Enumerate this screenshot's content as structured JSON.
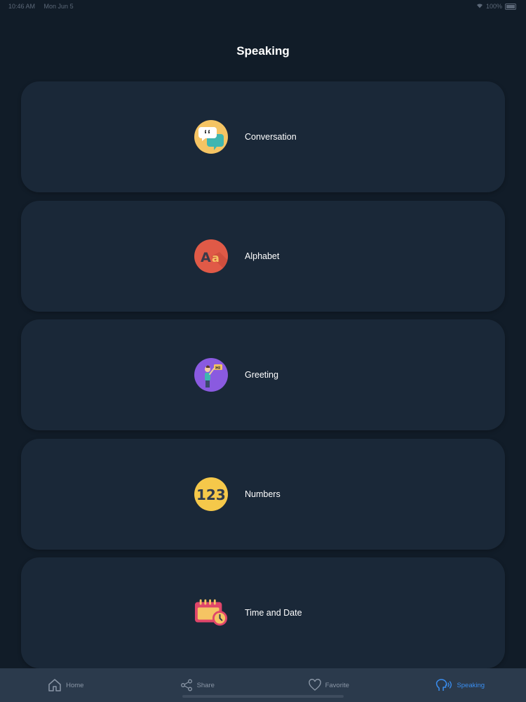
{
  "status_bar": {
    "time": "10:46 AM",
    "date": "Mon Jun 5",
    "battery": "100%"
  },
  "header": {
    "title": "Speaking"
  },
  "categories": [
    {
      "label": "Conversation",
      "icon": "speech-bubbles-icon"
    },
    {
      "label": "Alphabet",
      "icon": "alphabet-aa-icon"
    },
    {
      "label": "Greeting",
      "icon": "person-hi-icon"
    },
    {
      "label": "Numbers",
      "icon": "numbers-123-icon"
    },
    {
      "label": "Time and Date",
      "icon": "calendar-clock-icon"
    }
  ],
  "tab_bar": {
    "items": [
      {
        "label": "Home",
        "icon": "home-icon",
        "active": false
      },
      {
        "label": "Share",
        "icon": "share-icon",
        "active": false
      },
      {
        "label": "Favorite",
        "icon": "heart-icon",
        "active": false
      },
      {
        "label": "Speaking",
        "icon": "speaking-head-icon",
        "active": true
      }
    ]
  },
  "colors": {
    "background": "#111c28",
    "card": "#1a2838",
    "tab_bar": "#2b3a4c",
    "tab_active": "#3a8ef0",
    "tab_inactive": "#8a96a6"
  }
}
